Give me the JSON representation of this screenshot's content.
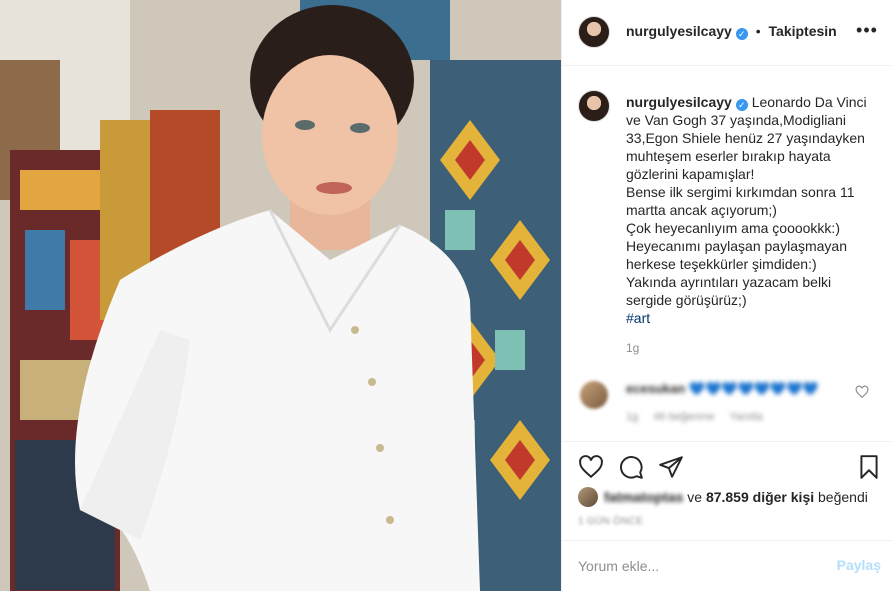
{
  "post": {
    "username": "nurgulyesilcayy",
    "verified": true,
    "follow_status": "Takiptesin",
    "more_icon": "more-horizontal-icon"
  },
  "caption": {
    "lines": [
      "Leonardo Da Vinci",
      "ve Van Gogh 37 yaşında,Modigliani",
      "33,Egon Shiele henüz 27 yaşındayken",
      "muhteşem eserler bırakıp hayata",
      "gözlerini kapamışlar!",
      "Bense ilk sergimi kırkımdan sonra 11",
      "martta ancak açıyorum;)",
      "Çok heyecanlıyım ama çooookkk:)",
      "Heyecanımı paylaşan paylaşmayan",
      "herkese teşekkürler şimdiden:)",
      "Yakında ayrıntıları yazacam belki",
      "sergide görüşürüz;)"
    ],
    "hashtag": "#art",
    "time": "1g"
  },
  "comment": {
    "username": "ecesukan",
    "text": "💙💙💙💙💙💙💙💙",
    "time": "1g",
    "likes": "46 beğenme",
    "reply": "Yanıtla"
  },
  "actions": {
    "like_icon": "heart-icon",
    "comment_icon": "comment-icon",
    "share_icon": "share-icon",
    "save_icon": "bookmark-icon"
  },
  "likes": {
    "first_user": "fatmatoptas",
    "connector": "ve",
    "count": "87.859 diğer kişi",
    "suffix": "beğendi"
  },
  "date": "1 gün önce",
  "comment_box": {
    "placeholder": "Yorum ekle...",
    "post_label": "Paylaş"
  },
  "colors": {
    "link_blue": "#00376b",
    "verified_blue": "#3897f0",
    "post_button_disabled": "#b2dffc",
    "muted_text": "#8e8e8e"
  }
}
